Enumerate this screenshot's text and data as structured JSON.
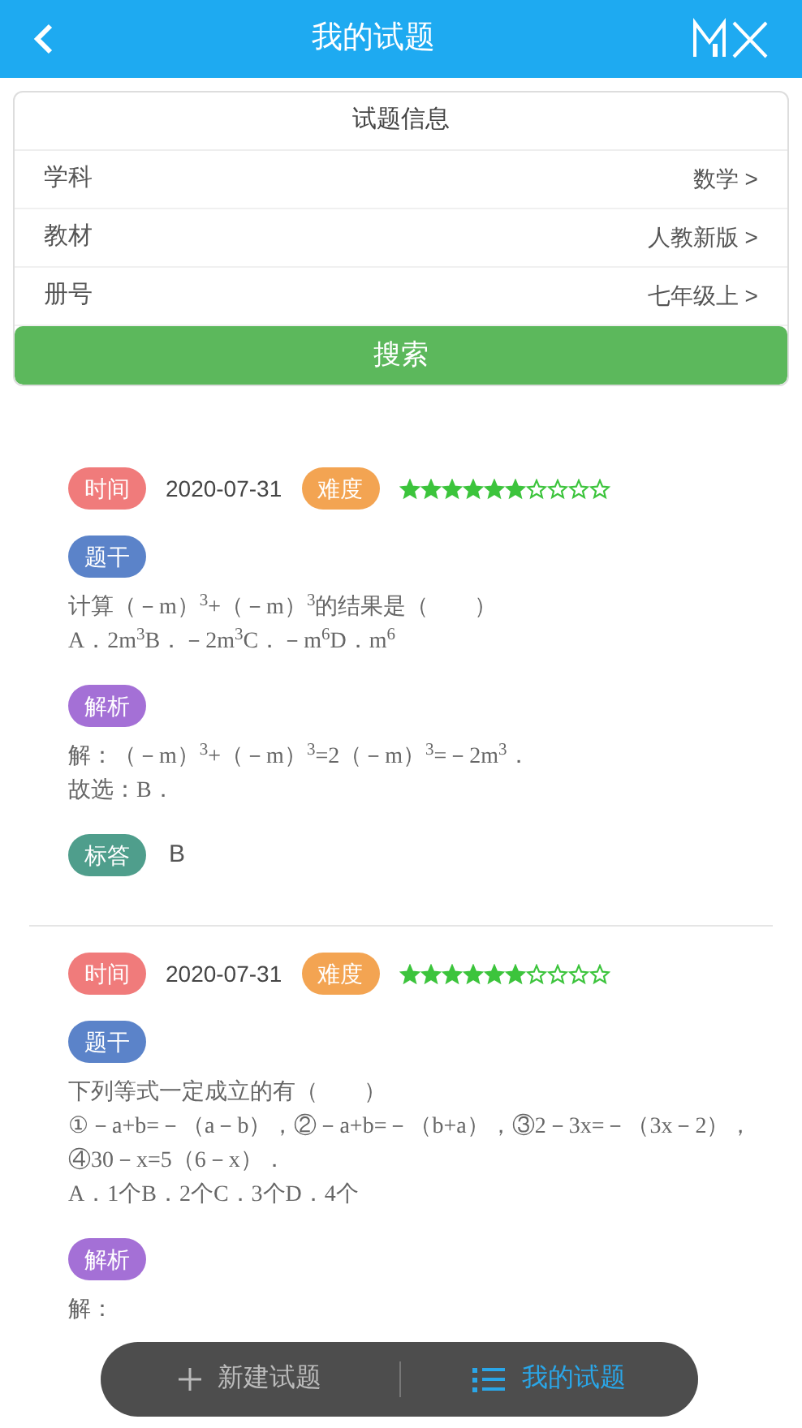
{
  "header": {
    "title": "我的试题"
  },
  "info_card": {
    "title": "试题信息",
    "rows": [
      {
        "label": "学科",
        "value": "数学 >"
      },
      {
        "label": "教材",
        "value": "人教新版 >"
      },
      {
        "label": "册号",
        "value": "七年级上 >"
      }
    ],
    "search_button": "搜索"
  },
  "questions": [
    {
      "time_tag": {
        "label": "时间",
        "color": "#f07b7b"
      },
      "date": "2020-07-31",
      "difficulty_tag": {
        "label": "难度",
        "color": "#f3a452"
      },
      "stars": 6,
      "sections": [
        {
          "tag": {
            "label": "题干",
            "color": "#5b83c9"
          },
          "lines": [
            "计算（－m）$^{3}$+（－m）$^{3}$的结果是（　　）",
            "A．2m$^{3}$B．－2m$^{3}$C．－m$^{6}$D．m$^{6}$"
          ],
          "kind": "text"
        },
        {
          "tag": {
            "label": "解析",
            "color": "#a470d6"
          },
          "lines": [
            "解：（－m）$^{3}$+（－m）$^{3}$=2（－m）$^{3}$=－2m$^{3}$．",
            "故选：B．"
          ],
          "kind": "text"
        },
        {
          "tag": {
            "label": "标答",
            "color": "#4f9e8c"
          },
          "lines": [
            "B"
          ],
          "kind": "answer"
        }
      ]
    },
    {
      "time_tag": {
        "label": "时间",
        "color": "#f07b7b"
      },
      "date": "2020-07-31",
      "difficulty_tag": {
        "label": "难度",
        "color": "#f3a452"
      },
      "stars": 6,
      "sections": [
        {
          "tag": {
            "label": "题干",
            "color": "#5b83c9"
          },
          "lines": [
            "下列等式一定成立的有（　　）",
            "①－a+b=－（a－b），②－a+b=－（b+a），③2－3x=－（3x－2），④30－x=5（6－x）．",
            "A．1个B．2个C．3个D．4个"
          ],
          "kind": "text"
        },
        {
          "tag": {
            "label": "解析",
            "color": "#a470d6"
          },
          "lines": [
            "解："
          ],
          "kind": "text"
        }
      ]
    }
  ],
  "bottom_bar": {
    "items": [
      {
        "label": "新建试题",
        "selected": false
      },
      {
        "label": "我的试题",
        "selected": true
      }
    ]
  }
}
